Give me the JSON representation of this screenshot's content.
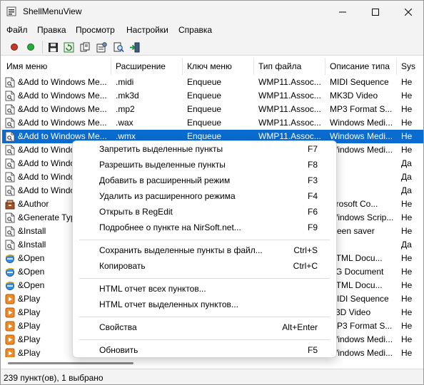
{
  "window": {
    "title": "ShellMenuView"
  },
  "menubar": [
    "Файл",
    "Правка",
    "Просмотр",
    "Настройки",
    "Справка"
  ],
  "toolbar": {
    "buttons": [
      "red-dot-icon",
      "green-dot-icon",
      "save-icon",
      "refresh-icon",
      "copy-icon",
      "properties-icon",
      "find-icon",
      "exit-icon"
    ]
  },
  "columns": [
    "Имя меню",
    "Расширение",
    "Ключ меню",
    "Тип файла",
    "Описание типа",
    "Sys"
  ],
  "rows": [
    {
      "icon": "doc",
      "name": "&Add to Windows Me...",
      "ext": ".midi",
      "key": "Enqueue",
      "type": "WMP11.Assoc...",
      "desc": "MIDI Sequence",
      "sys": "He"
    },
    {
      "icon": "doc",
      "name": "&Add to Windows Me...",
      "ext": ".mk3d",
      "key": "Enqueue",
      "type": "WMP11.Assoc...",
      "desc": "MK3D Video",
      "sys": "He"
    },
    {
      "icon": "doc",
      "name": "&Add to Windows Me...",
      "ext": ".mp2",
      "key": "Enqueue",
      "type": "WMP11.Assoc...",
      "desc": "MP3 Format S...",
      "sys": "He"
    },
    {
      "icon": "doc",
      "name": "&Add to Windows Me...",
      "ext": ".wax",
      "key": "Enqueue",
      "type": "WMP11.Assoc...",
      "desc": "Windows Medi...",
      "sys": "He"
    },
    {
      "icon": "doc",
      "name": "&Add to Windows Me...",
      "ext": ".wmx",
      "key": "Enqueue",
      "type": "WMP11.Assoc...",
      "desc": "Windows Medi...",
      "sys": "He",
      "selected": true
    },
    {
      "icon": "doc",
      "name": "&Add to Windo",
      "ext": "",
      "key": "",
      "type": "",
      "desc": "Windows Medi...",
      "sys": "He"
    },
    {
      "icon": "doc",
      "name": "&Add to Windo",
      "ext": "",
      "key": "",
      "type": "",
      "desc": "",
      "sys": "Да"
    },
    {
      "icon": "doc",
      "name": "&Add to Windo",
      "ext": "",
      "key": "",
      "type": "",
      "desc": "",
      "sys": "Да"
    },
    {
      "icon": "doc",
      "name": "&Add to Windo",
      "ext": "",
      "key": "",
      "type": "",
      "desc": "",
      "sys": "Да"
    },
    {
      "icon": "author",
      "name": "&Author",
      "ext": "",
      "key": "",
      "type": "",
      "desc": "icrosoft Co...",
      "sys": "He"
    },
    {
      "icon": "doc",
      "name": "&Generate Typ",
      "ext": "",
      "key": "",
      "type": "",
      "desc": "Windows Scrip...",
      "sys": "He"
    },
    {
      "icon": "doc",
      "name": "&Install",
      "ext": "",
      "key": "",
      "type": "",
      "desc": "creen saver",
      "sys": "He"
    },
    {
      "icon": "doc",
      "name": "&Install",
      "ext": "",
      "key": "",
      "type": "",
      "desc": "",
      "sys": "Да"
    },
    {
      "icon": "ie",
      "name": "&Open",
      "ext": "",
      "key": "",
      "type": "",
      "desc": "HTML Docu...",
      "sys": "He"
    },
    {
      "icon": "ie",
      "name": "&Open",
      "ext": "",
      "key": "",
      "type": "",
      "desc": "VG Document",
      "sys": "He"
    },
    {
      "icon": "ie",
      "name": "&Open",
      "ext": "",
      "key": "",
      "type": "",
      "desc": "HTML Docu...",
      "sys": "He"
    },
    {
      "icon": "play",
      "name": "&Play",
      "ext": "",
      "key": "",
      "type": "",
      "desc": "MIDI Sequence",
      "sys": "He"
    },
    {
      "icon": "play",
      "name": "&Play",
      "ext": "",
      "key": "",
      "type": "",
      "desc": "K3D Video",
      "sys": "He"
    },
    {
      "icon": "play",
      "name": "&Play",
      "ext": "",
      "key": "",
      "type": "",
      "desc": "MP3 Format S...",
      "sys": "He"
    },
    {
      "icon": "play",
      "name": "&Play",
      "ext": "",
      "key": "",
      "type": "",
      "desc": "Windows Medi...",
      "sys": "He"
    },
    {
      "icon": "play",
      "name": "&Play",
      "ext": "",
      "key": "",
      "type": "",
      "desc": "Windows Medi...",
      "sys": "He"
    }
  ],
  "context_menu": [
    {
      "label": "Запретить выделенные пункты",
      "shortcut": "F7"
    },
    {
      "label": "Разрешить выделенные пункты",
      "shortcut": "F8"
    },
    {
      "label": "Добавить в расширенный режим",
      "shortcut": "F3"
    },
    {
      "label": "Удалить из расширенного режима",
      "shortcut": "F4"
    },
    {
      "label": "Открыть в RegEdit",
      "shortcut": "F6"
    },
    {
      "label": "Подробнее о пункте на NirSoft.net...",
      "shortcut": "F9"
    },
    {
      "separator": true
    },
    {
      "label": "Сохранить выделенные пункты в файл...",
      "shortcut": "Ctrl+S"
    },
    {
      "label": "Копировать",
      "shortcut": "Ctrl+C"
    },
    {
      "separator": true
    },
    {
      "label": "HTML отчет всех пунктов...",
      "shortcut": ""
    },
    {
      "label": "HTML отчет выделенных пунктов...",
      "shortcut": ""
    },
    {
      "separator": true
    },
    {
      "label": "Свойства",
      "shortcut": "Alt+Enter"
    },
    {
      "separator": true
    },
    {
      "label": "Обновить",
      "shortcut": "F5"
    }
  ],
  "status": {
    "text": "239 пункт(ов), 1 выбрано"
  },
  "colors": {
    "selection": "#0a6cd0",
    "chrome": "#f3f3f3"
  }
}
